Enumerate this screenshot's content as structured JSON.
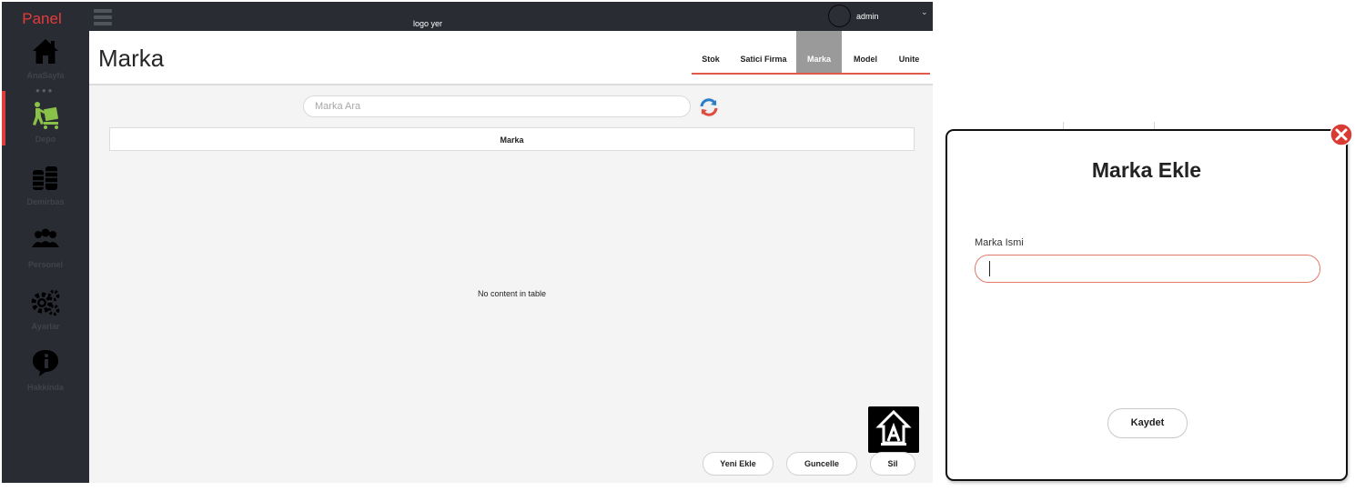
{
  "sidebar": {
    "brand": "Panel",
    "items": [
      {
        "label": "AnaSayfa",
        "icon": "home-icon"
      },
      {
        "label": "Depo",
        "icon": "warehouse-worker-icon"
      },
      {
        "label": "Demirbas",
        "icon": "stacked-coins-icon"
      },
      {
        "label": "Personel",
        "icon": "people-icon"
      },
      {
        "label": "Ayarlar",
        "icon": "gears-icon"
      },
      {
        "label": "Hakkinda",
        "icon": "info-icon"
      }
    ],
    "active_item": "Depo"
  },
  "topbar": {
    "logo": "logo yer",
    "user": "admin"
  },
  "header": {
    "title": "Marka",
    "tabs": [
      {
        "label": "Stok"
      },
      {
        "label": "Satici Firma"
      },
      {
        "label": "Marka"
      },
      {
        "label": "Model"
      },
      {
        "label": "Unite"
      }
    ],
    "active_tab": "Marka"
  },
  "search": {
    "placeholder": "Marka Ara",
    "value": ""
  },
  "table": {
    "columns": [
      "Marka"
    ],
    "rows": [],
    "empty_message": "No content in table"
  },
  "actions": {
    "new": "Yeni Ekle",
    "update": "Guncelle",
    "delete": "Sil",
    "float_icon": "brand-logo-icon"
  },
  "dialog": {
    "title": "Marka Ekle",
    "field_label": "Marka Ismi",
    "field_value": "",
    "save": "Kaydet"
  },
  "colors": {
    "sidebar_bg": "#292c33",
    "accent": "#e23b3b",
    "active_tab_bg": "#9a9a9a",
    "tab_underline": "#e05a4a",
    "depo_icon": "#8ac249"
  }
}
